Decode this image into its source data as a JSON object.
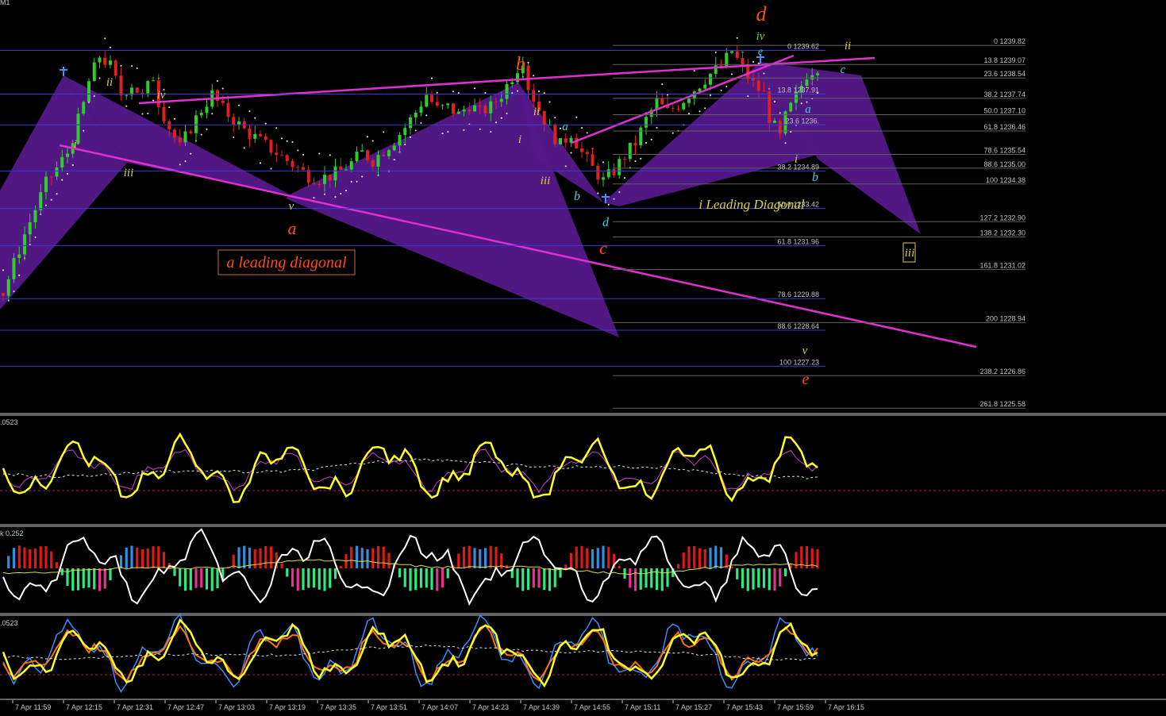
{
  "header": {
    "symbol_tag": "M1",
    "panel1_value": ".0523",
    "panel2_value": "k 0.252",
    "panel3_value": ".0523"
  },
  "chart_data": {
    "type": "candlestick",
    "title": "",
    "time_labels": [
      "7 Apr 11:59",
      "7 Apr 12:15",
      "7 Apr 12:31",
      "7 Apr 12:47",
      "7 Apr 13:03",
      "7 Apr 13:19",
      "7 Apr 13:35",
      "7 Apr 13:51",
      "7 Apr 14:07",
      "7 Apr 14:23",
      "7 Apr 14:39",
      "7 Apr 14:55",
      "7 Apr 15:11",
      "7 Apr 15:27",
      "7 Apr 15:43",
      "7 Apr 15:59",
      "7 Apr 16:15"
    ],
    "price_range": [
      1225.4,
      1241.6
    ],
    "close_path": [
      [
        0,
        1230.1
      ],
      [
        4,
        1232.4
      ],
      [
        8,
        1234.4
      ],
      [
        12,
        1235.6
      ],
      [
        15,
        1237.5
      ],
      [
        16,
        1238.4
      ],
      [
        18,
        1239.4
      ],
      [
        20,
        1239.0
      ],
      [
        22,
        1237.9
      ],
      [
        24,
        1238.3
      ],
      [
        26,
        1237.8
      ],
      [
        28,
        1238.6
      ],
      [
        29,
        1237.6
      ],
      [
        31,
        1236.6
      ],
      [
        33,
        1235.8
      ],
      [
        35,
        1236.6
      ],
      [
        37,
        1237.3
      ],
      [
        39,
        1237.9
      ],
      [
        41,
        1237.3
      ],
      [
        43,
        1236.9
      ],
      [
        45,
        1236.5
      ],
      [
        47,
        1236.2
      ],
      [
        49,
        1235.9
      ],
      [
        51,
        1235.6
      ],
      [
        53,
        1235.3
      ],
      [
        55,
        1235.0
      ],
      [
        57,
        1234.7
      ],
      [
        59,
        1234.6
      ],
      [
        61,
        1234.7
      ],
      [
        63,
        1234.9
      ],
      [
        65,
        1235.2
      ],
      [
        67,
        1235.6
      ],
      [
        69,
        1235.3
      ],
      [
        71,
        1235.7
      ],
      [
        73,
        1236.1
      ],
      [
        75,
        1236.6
      ],
      [
        77,
        1237.2
      ],
      [
        79,
        1237.9
      ],
      [
        81,
        1237.3
      ],
      [
        83,
        1237.4
      ],
      [
        85,
        1237.1
      ],
      [
        87,
        1237.5
      ],
      [
        89,
        1237.2
      ],
      [
        91,
        1237.4
      ],
      [
        93,
        1237.9
      ],
      [
        95,
        1238.6
      ],
      [
        97,
        1239.3
      ],
      [
        98,
        1238.2
      ],
      [
        100,
        1237.3
      ],
      [
        102,
        1236.5
      ],
      [
        104,
        1235.9
      ],
      [
        106,
        1236.4
      ],
      [
        108,
        1235.6
      ],
      [
        110,
        1235.0
      ],
      [
        112,
        1234.5
      ],
      [
        114,
        1234.9
      ],
      [
        116,
        1235.5
      ],
      [
        118,
        1236.0
      ],
      [
        120,
        1236.9
      ],
      [
        122,
        1237.6
      ],
      [
        124,
        1237.2
      ],
      [
        126,
        1237.5
      ],
      [
        128,
        1237.9
      ],
      [
        130,
        1238.3
      ],
      [
        132,
        1238.7
      ],
      [
        134,
        1239.0
      ],
      [
        136,
        1239.6
      ],
      [
        138,
        1238.9
      ],
      [
        140,
        1238.3
      ],
      [
        142,
        1237.9
      ],
      [
        143,
        1237.0
      ],
      [
        145,
        1236.2
      ],
      [
        146,
        1237.0
      ],
      [
        148,
        1237.8
      ],
      [
        150,
        1238.7
      ],
      [
        152,
        1239.0
      ]
    ],
    "fib_levels_left": [
      {
        "label": "0 1239.62",
        "price": 1239.62
      },
      {
        "label": "13.8 1237.91",
        "price": 1237.91
      },
      {
        "label": "23.6 1236.",
        "price": 1236.7
      },
      {
        "label": "38.2 1234.89",
        "price": 1234.89
      },
      {
        "label": "50.0 1233.42",
        "price": 1233.42
      },
      {
        "label": "61.8 1231.96",
        "price": 1231.96
      },
      {
        "label": "78.6 1229.88",
        "price": 1229.88
      },
      {
        "label": "88.6 1228.64",
        "price": 1228.64
      },
      {
        "label": "100 1227.23",
        "price": 1227.23
      }
    ],
    "fib_levels_right": [
      {
        "label": "0 1239.82",
        "price": 1239.82
      },
      {
        "label": "13.8 1239.07",
        "price": 1239.07
      },
      {
        "label": "23.6 1238.54",
        "price": 1238.54
      },
      {
        "label": "38.2 1237.74",
        "price": 1237.74
      },
      {
        "label": "50.0 1237.10",
        "price": 1237.1
      },
      {
        "label": "61.8 1236.46",
        "price": 1236.46
      },
      {
        "label": "78.6 1235.54",
        "price": 1235.54
      },
      {
        "label": "88.6 1235.00",
        "price": 1235.0
      },
      {
        "label": "100 1234.38",
        "price": 1234.38
      },
      {
        "label": "127.2 1232.90",
        "price": 1232.9
      },
      {
        "label": "138.2 1232.30",
        "price": 1232.3
      },
      {
        "label": "161.8 1231.02",
        "price": 1231.02
      },
      {
        "label": "200 1228.94",
        "price": 1228.94
      },
      {
        "label": "238.2 1226.86",
        "price": 1226.86
      },
      {
        "label": "261.8 1225.58",
        "price": 1225.58
      }
    ],
    "wave_labels": [
      {
        "text": "ii",
        "color": "#d8d040"
      },
      {
        "text": "iv",
        "color": "#d8d040"
      },
      {
        "text": "i",
        "color": "#d8d040"
      },
      {
        "text": "iii",
        "color": "#d8d040"
      },
      {
        "text": "v",
        "color": "#d8d040"
      },
      {
        "text": "a",
        "color": "#ff4a1a"
      },
      {
        "text": "b",
        "color": "#ff4a1a"
      },
      {
        "text": "ii",
        "color": "#d8d040"
      },
      {
        "text": "i",
        "color": "#d8d040"
      },
      {
        "text": "iii",
        "color": "#d8d040"
      },
      {
        "text": "a",
        "color": "#40d0e0"
      },
      {
        "text": "b",
        "color": "#40d0e0"
      },
      {
        "text": "d",
        "color": "#40d0e0"
      },
      {
        "text": "c",
        "color": "#ff4a1a"
      },
      {
        "text": "d",
        "color": "#ff4a1a"
      },
      {
        "text": "iv",
        "color": "#7ed040"
      },
      {
        "text": "e",
        "color": "#40d0e0"
      },
      {
        "text": "ii",
        "color": "#d8d040"
      },
      {
        "text": "c",
        "color": "#40d0e0"
      },
      {
        "text": "a",
        "color": "#40d0e0"
      },
      {
        "text": "i",
        "color": "#d8d040"
      },
      {
        "text": "b",
        "color": "#40d0e0"
      },
      {
        "text": "v",
        "color": "#d8d040"
      },
      {
        "text": "e",
        "color": "#ff4a1a"
      },
      {
        "text": "iii",
        "color": "#d8d040"
      }
    ],
    "annotations": [
      {
        "text": "a leading diagonal",
        "color": "#ff4a1a"
      },
      {
        "text": "i Leading Diagonal",
        "color": "#d8d040"
      }
    ]
  },
  "colors": {
    "background": "#000000",
    "pattern": "#55188a",
    "trendline": "#e030d0",
    "bull": "#2ecc2e",
    "bear": "#e02020",
    "level": "#3a3acc",
    "osc": "#ffff20",
    "hist_up": "#e01818",
    "hist_down": "#30e880",
    "hist_blue": "#3090e0"
  }
}
